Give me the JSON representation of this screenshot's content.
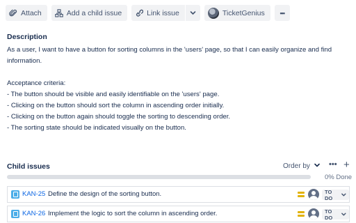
{
  "toolbar": {
    "attach_label": "Attach",
    "add_child_label": "Add a child issue",
    "link_issue_label": "Link issue",
    "app_label": "TicketGenius",
    "more_label": "•••"
  },
  "description": {
    "title": "Description",
    "intro": "As a user, I want to have a button for sorting columns in the 'users' page, so that I can easily organize and find information.",
    "criteria_heading": "Acceptance criteria:",
    "criteria": [
      "- The button should be visible and easily identifiable on the 'users' page.",
      "- Clicking on the button should sort the column in ascending order initially.",
      "- Clicking on the button again should toggle the sorting to descending order.",
      "- The sorting state should be indicated visually on the button."
    ]
  },
  "child_issues": {
    "title": "Child issues",
    "order_by_label": "Order by",
    "more_label": "•••",
    "add_label": "+",
    "progress_percent": 0,
    "progress_label": "0% Done",
    "items": [
      {
        "key": "KAN-25",
        "summary": "Define the design of the sorting button.",
        "status": "TO DO"
      },
      {
        "key": "KAN-26",
        "summary": "Implement the logic to sort the column in ascending order.",
        "status": "TO DO"
      }
    ]
  },
  "colors": {
    "link": "#0c66e4",
    "task_icon": "#4bade8",
    "priority_medium": "#e2b203",
    "button_bg": "#f1f2f4"
  },
  "icons": {
    "attach": "paperclip-icon",
    "add_child": "hierarchy-icon",
    "link": "link-icon",
    "caret": "chevron-down-icon",
    "app": "avatar-icon",
    "task": "task-icon",
    "priority": "priority-medium-icon"
  }
}
